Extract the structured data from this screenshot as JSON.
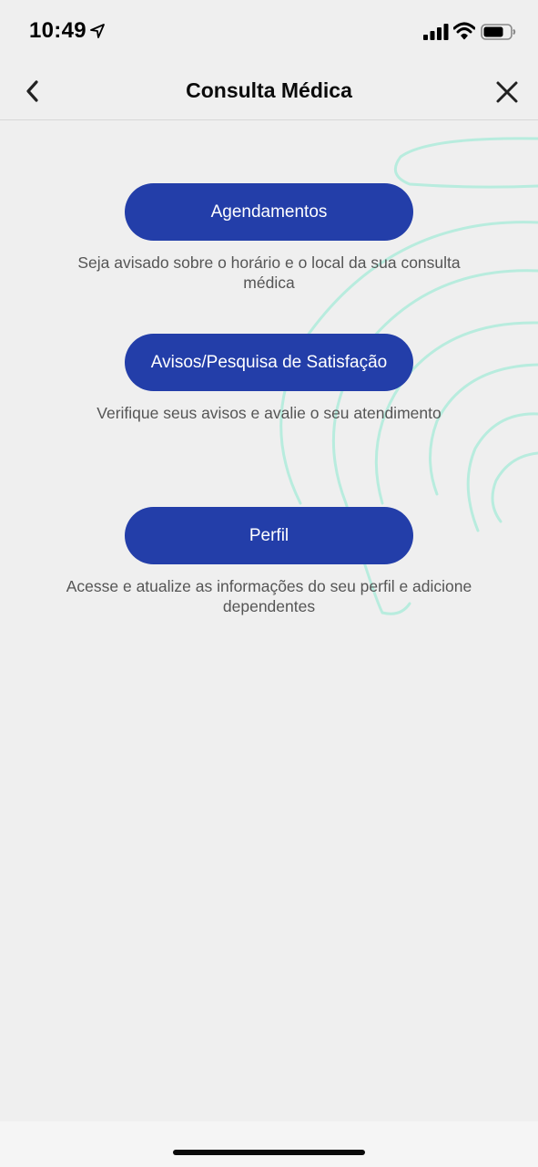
{
  "status_bar": {
    "time": "10:49"
  },
  "nav": {
    "title": "Consulta Médica",
    "back_icon": "chevron-left-icon",
    "close_icon": "close-icon"
  },
  "menu": [
    {
      "label": "Agendamentos",
      "description": "Seja avisado sobre o horário e o local da sua consulta médica"
    },
    {
      "label": "Avisos/Pesquisa de Satisfação",
      "description": "Verifique seus avisos e avalie o seu atendimento"
    },
    {
      "label": "Perfil",
      "description": "Acesse e atualize as informações do seu perfil e adicione dependentes"
    }
  ],
  "colors": {
    "background": "#efefef",
    "button": "#233ea9",
    "button_text": "#ffffff",
    "description_text": "#555555",
    "decor_accent": "#b8ecde"
  }
}
